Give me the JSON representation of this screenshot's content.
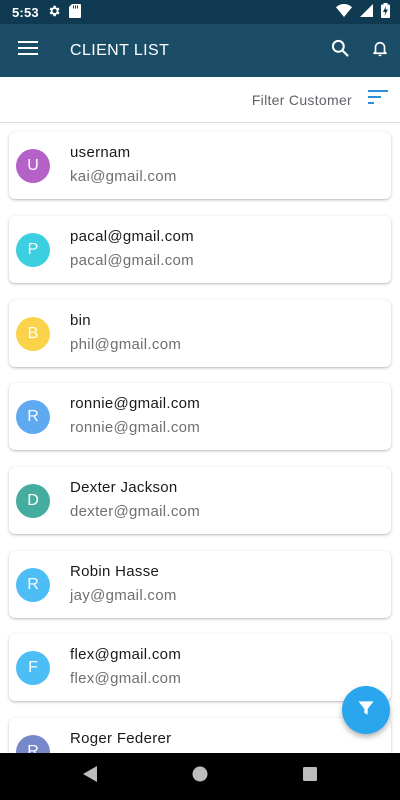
{
  "status_bar": {
    "time": "5:53"
  },
  "app_bar": {
    "title": "CLIENT LIST"
  },
  "filter": {
    "label": "Filter Customer"
  },
  "clients": [
    {
      "initial": "U",
      "name": "usernam",
      "email": "kai@gmail.com",
      "avatar_color": "#b462c8"
    },
    {
      "initial": "P",
      "name": "pacal@gmail.com",
      "email": "pacal@gmail.com",
      "avatar_color": "#3ccfe0"
    },
    {
      "initial": "B",
      "name": "bin",
      "email": "phil@gmail.com",
      "avatar_color": "#fbd34a"
    },
    {
      "initial": "R",
      "name": "ronnie@gmail.com",
      "email": "ronnie@gmail.com",
      "avatar_color": "#5fa9f0"
    },
    {
      "initial": "D",
      "name": "Dexter Jackson",
      "email": "dexter@gmail.com",
      "avatar_color": "#45ad9f"
    },
    {
      "initial": "R",
      "name": "Robin Hasse",
      "email": "jay@gmail.com",
      "avatar_color": "#4cbdf5"
    },
    {
      "initial": "F",
      "name": "flex@gmail.com",
      "email": "flex@gmail.com",
      "avatar_color": "#4cbdf5"
    },
    {
      "initial": "R",
      "name": "Roger Federer",
      "email": "",
      "avatar_color": "#7688c9"
    }
  ],
  "colors": {
    "status_bar": "#0f3a51",
    "app_bar": "#1b4d67",
    "accent": "#29a6ee"
  },
  "icons": {
    "menu": "menu-icon",
    "search": "search-icon",
    "notifications": "bell-icon",
    "sort": "sort-icon",
    "fab": "funnel-icon",
    "nav_back": "back-triangle-icon",
    "nav_home": "home-circle-icon",
    "nav_recents": "recents-square-icon"
  }
}
